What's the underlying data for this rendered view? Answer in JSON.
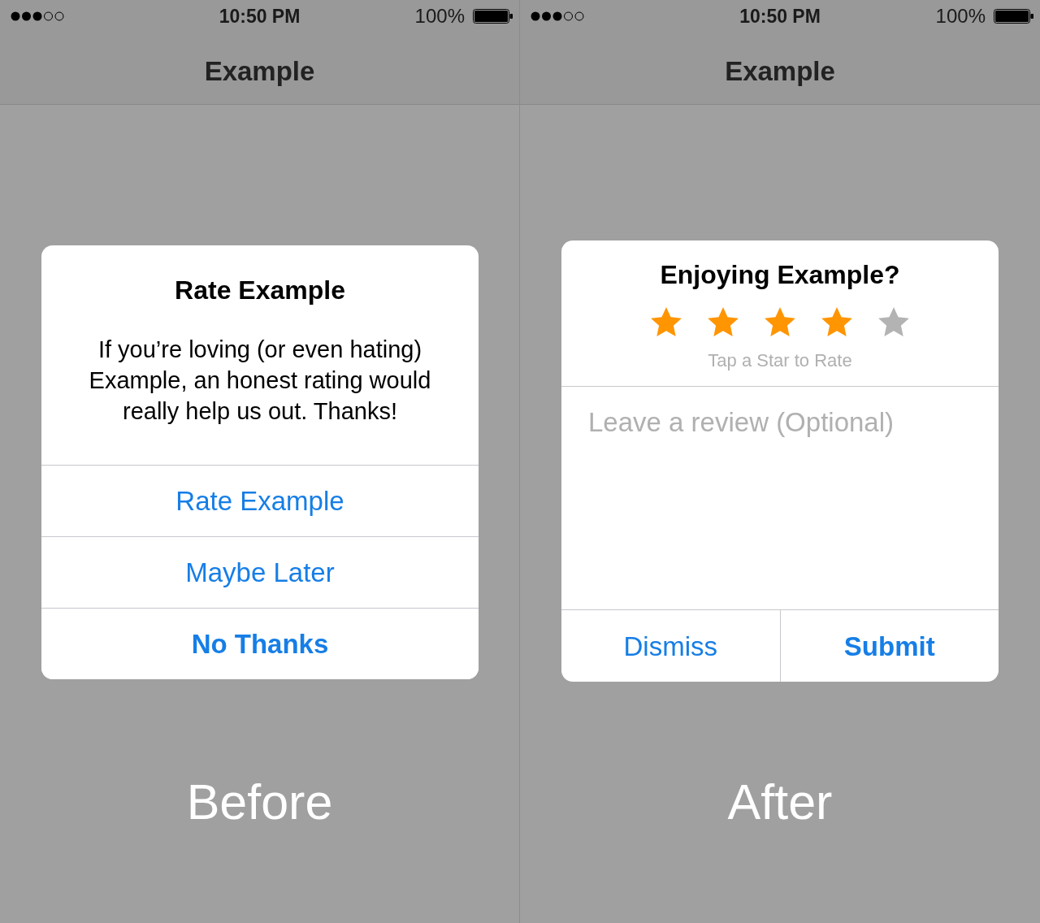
{
  "screens": [
    {
      "status_bar": {
        "time": "10:50 PM",
        "battery": "100%"
      },
      "nav_bar": {
        "title": "Example"
      },
      "dialog": {
        "kind": "alert",
        "title": "Rate Example",
        "message": "If you’re loving (or even hating) Example, an honest rating would really help us out. Thanks!",
        "buttons": [
          {
            "label": "Rate Example",
            "bold": false
          },
          {
            "label": "Maybe Later",
            "bold": false
          },
          {
            "label": "No Thanks",
            "bold": true
          }
        ]
      },
      "caption": "Before"
    },
    {
      "status_bar": {
        "time": "10:50 PM",
        "battery": "100%"
      },
      "nav_bar": {
        "title": "Example"
      },
      "dialog": {
        "kind": "rating",
        "title": "Enjoying Example?",
        "stars": 4,
        "hint": "Tap a Star to Rate",
        "review": {
          "placeholder": "Leave a review (Optional)"
        },
        "buttons": [
          {
            "label": "Dismiss",
            "bold": false
          },
          {
            "label": "Submit",
            "bold": true
          }
        ]
      },
      "caption": "After"
    }
  ]
}
